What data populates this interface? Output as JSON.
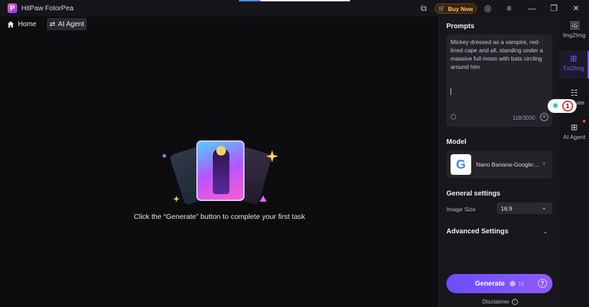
{
  "window": {
    "title": "HitPaw FotorPea",
    "logo_letter": "P",
    "buy_label": "Buy Now",
    "icons": [
      "screen-icon",
      "cart-icon",
      "account-icon",
      "menu-icon",
      "minimize-icon",
      "restore-icon",
      "close-icon"
    ]
  },
  "nav": {
    "home_label": "Home",
    "agent_label": "AI Agent"
  },
  "main": {
    "hint": "Click the “Generate” button to complete your first task"
  },
  "panel": {
    "prompts_title": "Prompts",
    "prompt_text": "Mickey dressed as a vampire, red-lined cape and all, standing under a massive full moon with bats circling around him",
    "prompt_count": "118/3000",
    "model_title": "Model",
    "model_name": "Nano Banana-Google:...",
    "model_logo": "G",
    "general_title": "General settings",
    "image_size_label": "Image Size",
    "image_size_value": "16:9",
    "advanced_title": "Advanced Settings",
    "generate_label": "Generate",
    "generate_cost": "16",
    "disclaimer_label": "Disclaimer"
  },
  "rail": {
    "items": [
      {
        "label": "Img2Img",
        "icon": "image-icon"
      },
      {
        "label": "Txt2Img",
        "icon": "text-image-icon",
        "active": true
      },
      {
        "label": "ate",
        "icon": "template-icon"
      },
      {
        "label": "AI Agent",
        "icon": "agent-icon"
      }
    ]
  },
  "badge": {
    "step": "1"
  },
  "colors": {
    "accent": "#7d63ff",
    "buy_text": "#ffc36b",
    "background": "#0d0d10",
    "panel": "#17171c"
  }
}
